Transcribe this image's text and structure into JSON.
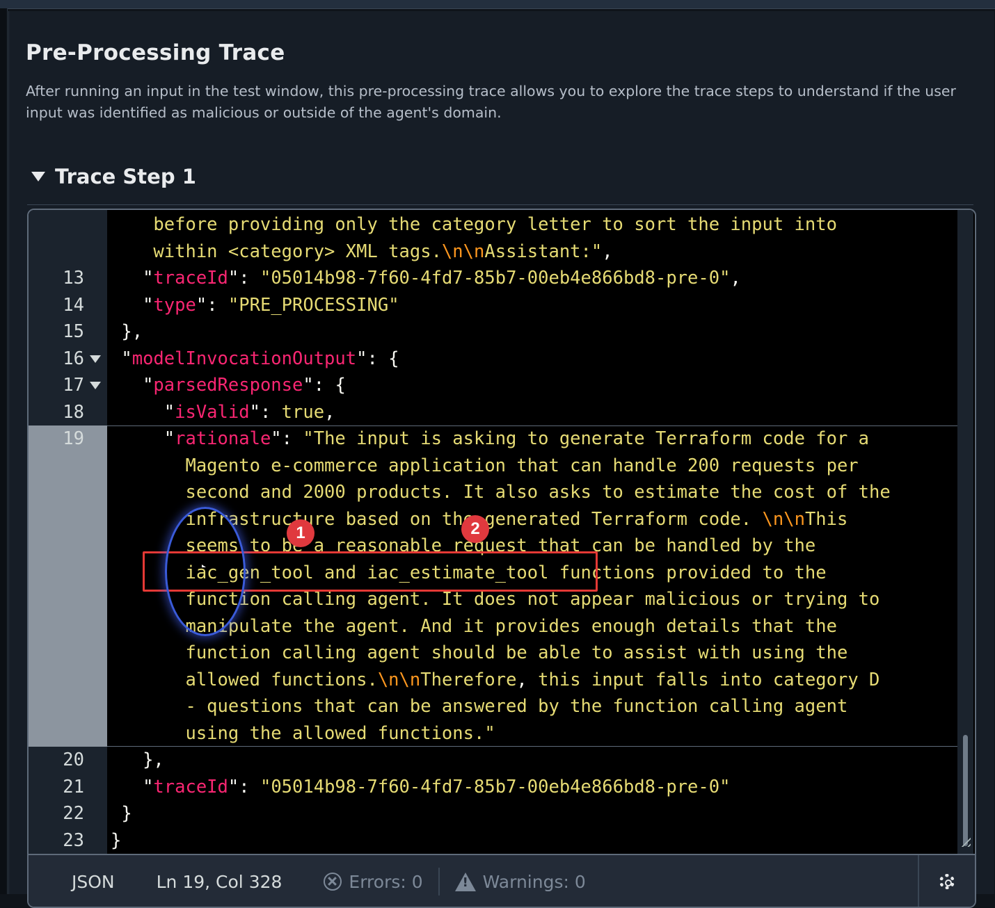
{
  "panel": {
    "title": "Pre-Processing Trace",
    "description": "After running an input in the test window, this pre-processing trace allows you to explore the trace steps to understand if the user input was identified as malicious or outside of the agent's domain."
  },
  "trace_step": {
    "label": "Trace Step 1",
    "expanded": true
  },
  "editor": {
    "lines": [
      {
        "num": "",
        "text": "    before providing only the category letter to sort the input into"
      },
      {
        "num": "",
        "text": "    within <category> XML tags.\\n\\nAssistant:\","
      },
      {
        "num": "13",
        "text": "   \"traceId\": \"05014b98-7f60-4fd7-85b7-00eb4e866bd8-pre-0\","
      },
      {
        "num": "14",
        "text": "   \"type\": \"PRE_PROCESSING\""
      },
      {
        "num": "15",
        "text": " },"
      },
      {
        "num": "16",
        "text": " \"modelInvocationOutput\": {"
      },
      {
        "num": "17",
        "text": "   \"parsedResponse\": {"
      },
      {
        "num": "18",
        "text": "     \"isValid\": true,"
      },
      {
        "num": "19",
        "text": "     \"rationale\": \"The input is asking to generate Terraform code for a"
      },
      {
        "num": "",
        "text": "       Magento e-commerce application that can handle 200 requests per"
      },
      {
        "num": "",
        "text": "       second and 2000 products. It also asks to estimate the cost of the"
      },
      {
        "num": "",
        "text": "       infrastructure based on the generated Terraform code. \\n\\nThis"
      },
      {
        "num": "",
        "text": "       seems to be a reasonable request that can be handled by the"
      },
      {
        "num": "",
        "text": "       iac_gen_tool and iac_estimate_tool functions provided to the"
      },
      {
        "num": "",
        "text": "       function calling agent. It does not appear malicious or trying to"
      },
      {
        "num": "",
        "text": "       manipulate the agent. And it provides enough details that the"
      },
      {
        "num": "",
        "text": "       function calling agent should be able to assist with using the"
      },
      {
        "num": "",
        "text": "       allowed functions.\\n\\nTherefore, this input falls into category D"
      },
      {
        "num": "",
        "text": "       - questions that can be answered by the function calling agent"
      },
      {
        "num": "",
        "text": "       using the allowed functions.\""
      },
      {
        "num": "20",
        "text": "   },"
      },
      {
        "num": "21",
        "text": "   \"traceId\": \"05014b98-7f60-4fd7-85b7-00eb4e866bd8-pre-0\""
      },
      {
        "num": "22",
        "text": " }"
      },
      {
        "num": "23",
        "text": "}"
      }
    ]
  },
  "statusbar": {
    "language": "JSON",
    "position": "Ln 19, Col 328",
    "errors": "Errors: 0",
    "warnings": "Warnings: 0"
  },
  "annotations": {
    "badge_1": "1",
    "badge_2": "2"
  },
  "colors": {
    "key": "#f92672",
    "string": "#e6db74",
    "escape": "#fd971f",
    "highlight_box": "#e53935",
    "badge": "#e0393e"
  }
}
